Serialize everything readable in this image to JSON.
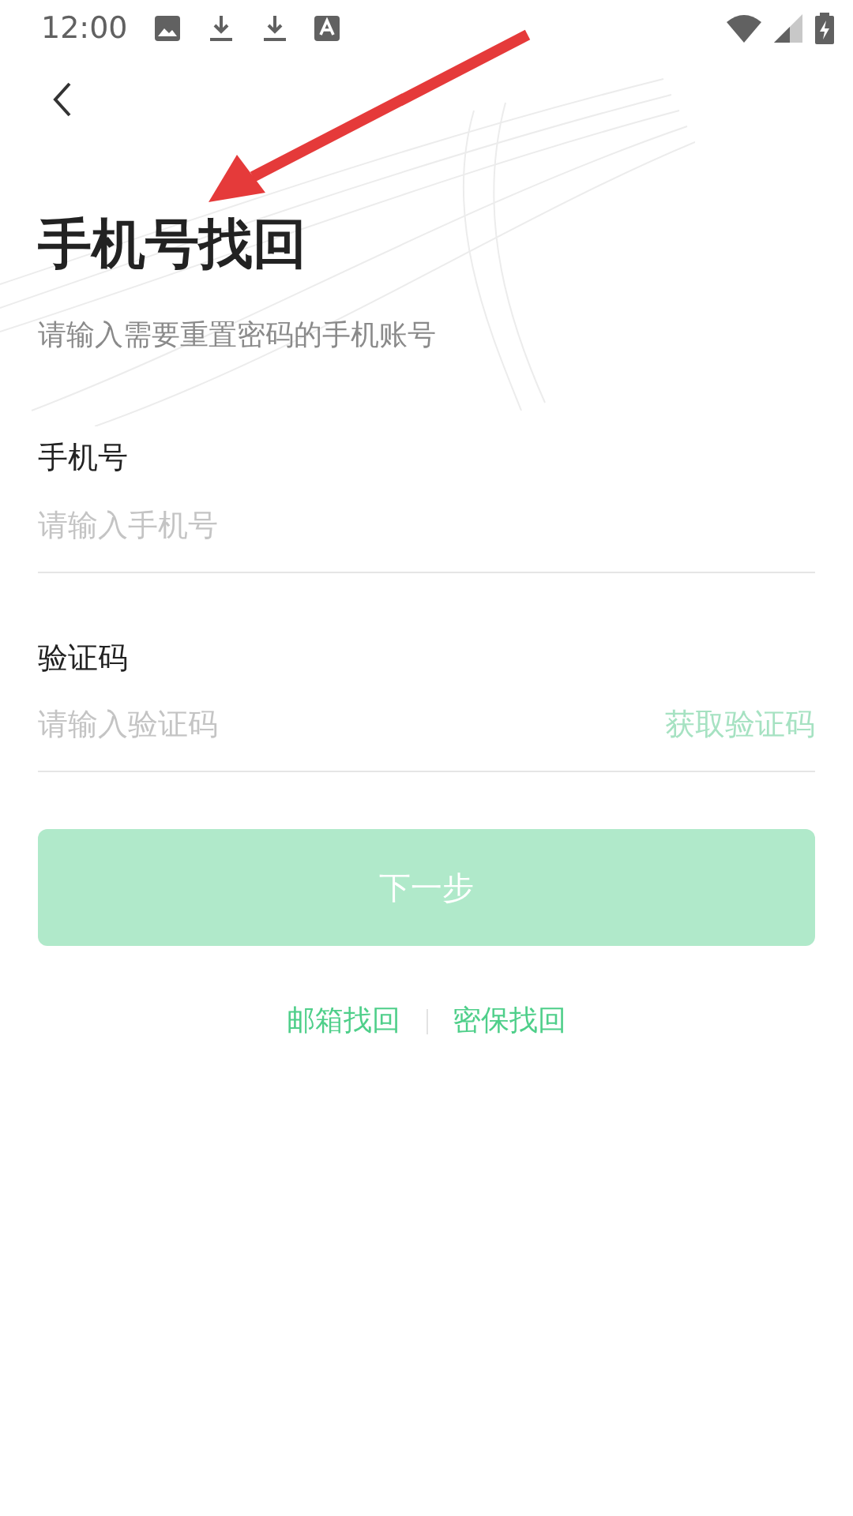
{
  "status_bar": {
    "time": "12:00"
  },
  "title": "手机号找回",
  "subtitle": "请输入需要重置密码的手机账号",
  "fields": [
    {
      "label": "手机号",
      "placeholder": "请输入手机号"
    },
    {
      "label": "验证码",
      "placeholder": "请输入验证码",
      "action": "获取验证码"
    }
  ],
  "next_button": {
    "label": "下一步",
    "disabled": true
  },
  "links": [
    "邮箱找回",
    "密保找回"
  ]
}
